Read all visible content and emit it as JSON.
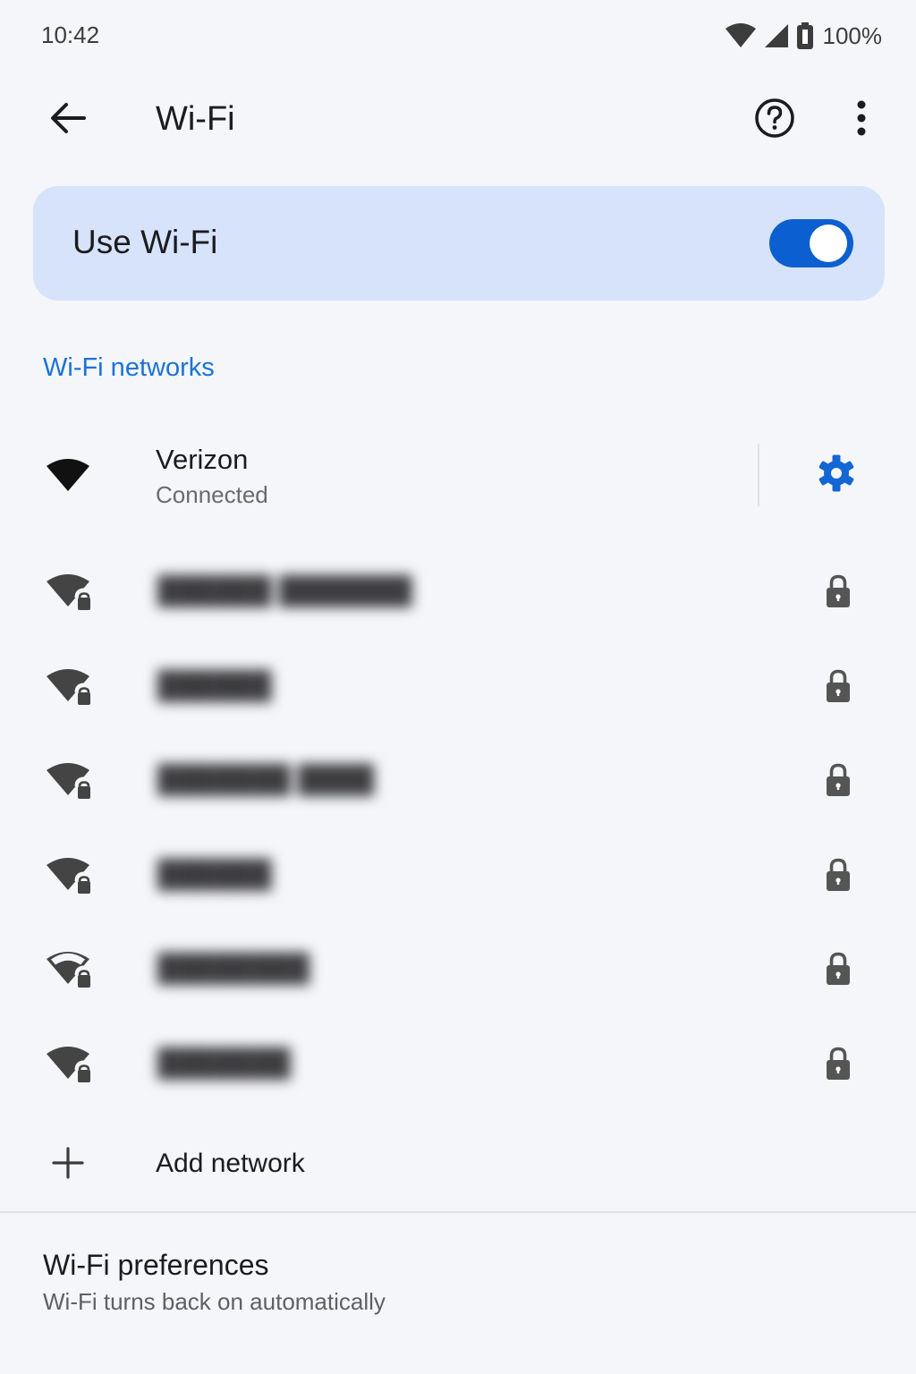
{
  "status_bar": {
    "time": "10:42",
    "battery": "100%",
    "icons": [
      "wifi-signal-icon",
      "cell-signal-icon",
      "battery-icon"
    ]
  },
  "app_bar": {
    "title": "Wi-Fi",
    "icons": [
      "back-arrow-icon",
      "help-icon",
      "more-vert-icon"
    ]
  },
  "use_wifi": {
    "label": "Use Wi-Fi",
    "enabled": true,
    "accent_color": "#0b5fd0",
    "card_color": "#d6e3fb"
  },
  "networks_header": "Wi-Fi networks",
  "connected_network": {
    "name": "Verizon",
    "status": "Connected",
    "icon": "wifi-full-icon",
    "settings_icon": "gear-icon"
  },
  "available_networks": [
    {
      "name": "██████ ███████",
      "signal": "full",
      "secured": true
    },
    {
      "name": "██████",
      "signal": "full",
      "secured": true
    },
    {
      "name": "███████ ████",
      "signal": "full",
      "secured": true
    },
    {
      "name": "██████",
      "signal": "full",
      "secured": true
    },
    {
      "name": "████████",
      "signal": "weak",
      "secured": true
    },
    {
      "name": "███████",
      "signal": "full",
      "secured": true
    }
  ],
  "add_network": {
    "label": "Add network",
    "icon": "plus-icon"
  },
  "preferences": {
    "title": "Wi-Fi preferences",
    "subtitle": "Wi-Fi turns back on automatically"
  }
}
